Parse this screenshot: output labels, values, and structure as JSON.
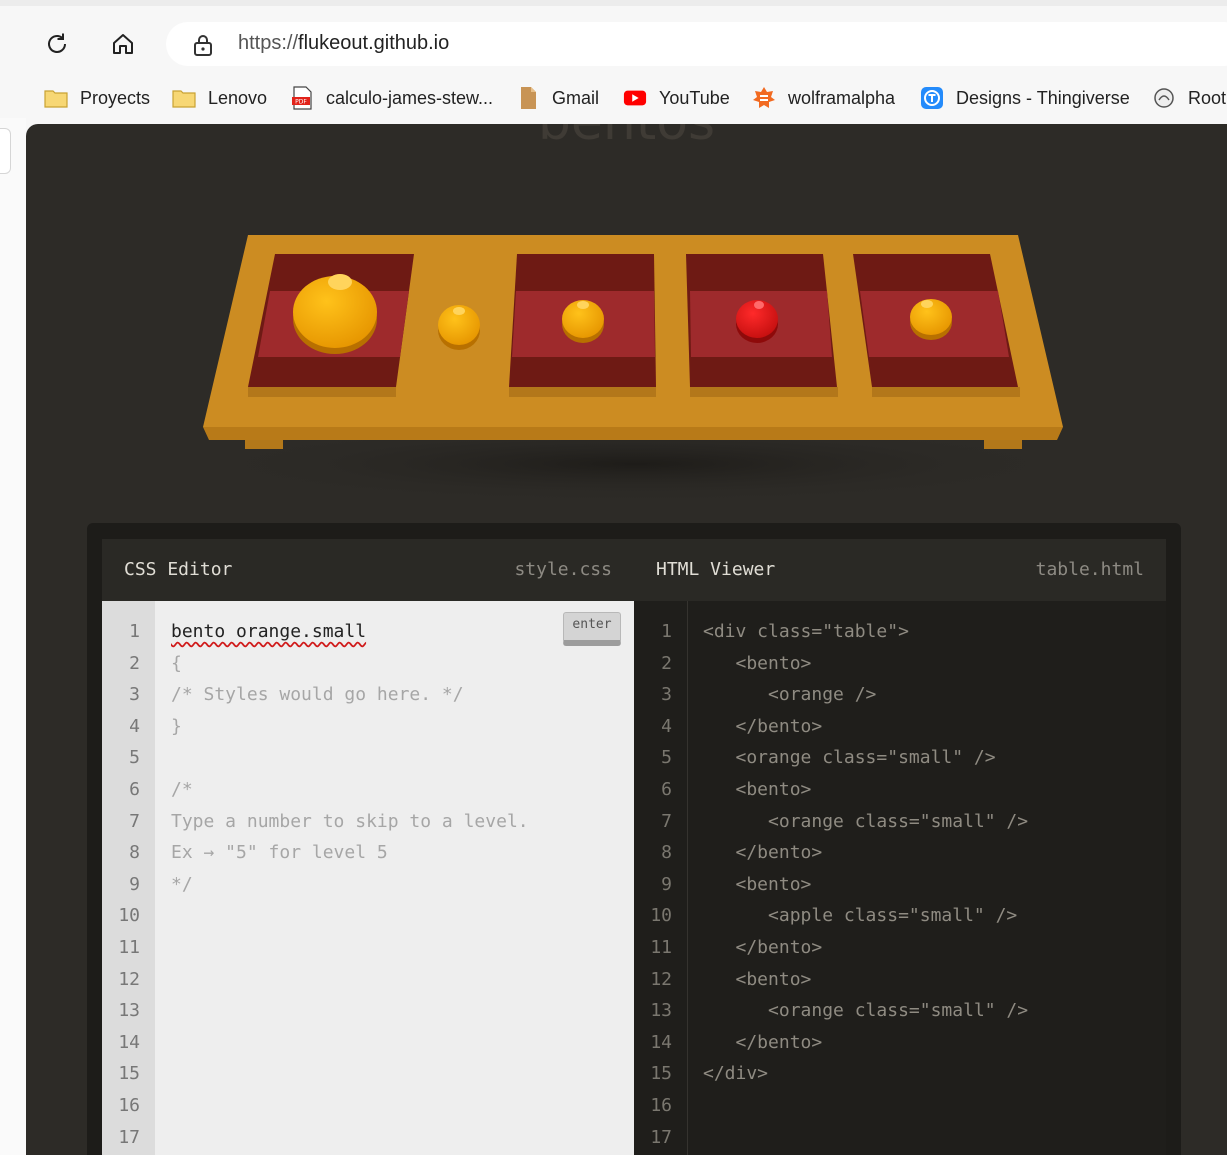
{
  "browser": {
    "url_protocol": "https://",
    "url_host": "flukeout.github.io",
    "bookmarks": [
      {
        "label": "Proyects",
        "icon": "folder-icon"
      },
      {
        "label": "Lenovo",
        "icon": "folder-icon"
      },
      {
        "label": "calculo-james-stew...",
        "icon": "pdf-icon"
      },
      {
        "label": "Gmail",
        "icon": "document-icon"
      },
      {
        "label": "YouTube",
        "icon": "youtube-icon"
      },
      {
        "label": "wolframalpha",
        "icon": "wolfram-icon"
      },
      {
        "label": "Designs - Thingiverse",
        "icon": "thingiverse-icon"
      },
      {
        "label": "Root",
        "icon": "root-icon"
      }
    ]
  },
  "game": {
    "title": "bentos",
    "colors": {
      "table": "#c98a1f",
      "bento": "#9c2a2a",
      "orange": "#f0a000",
      "apple": "#d81616",
      "page_bg": "#2d2b27"
    },
    "table_items": [
      {
        "type": "bento",
        "contains": "orange"
      },
      {
        "type": "orange",
        "class": "small"
      },
      {
        "type": "bento",
        "contains": "orange small"
      },
      {
        "type": "bento",
        "contains": "apple small"
      },
      {
        "type": "bento",
        "contains": "orange small"
      }
    ]
  },
  "css_editor": {
    "title": "CSS Editor",
    "file": "style.css",
    "input_value": "bento orange.small",
    "enter_label": "enter",
    "lines": [
      "",
      "{",
      "/* Styles would go here. */",
      "}",
      "",
      "/*",
      "Type a number to skip to a level.",
      "Ex → \"5\" for level 5",
      "*/"
    ],
    "line_numbers": [
      "1",
      "2",
      "3",
      "4",
      "5",
      "6",
      "7",
      "8",
      "9",
      "10",
      "11",
      "12",
      "13",
      "14",
      "15",
      "16",
      "17"
    ]
  },
  "html_viewer": {
    "title": "HTML Viewer",
    "file": "table.html",
    "lines": [
      "<div class=\"table\">",
      "   <bento>",
      "      <orange />",
      "   </bento>",
      "   <orange class=\"small\" />",
      "   <bento>",
      "      <orange class=\"small\" />",
      "   </bento>",
      "   <bento>",
      "      <apple class=\"small\" />",
      "   </bento>",
      "   <bento>",
      "      <orange class=\"small\" />",
      "   </bento>",
      "</div>"
    ],
    "line_numbers": [
      "1",
      "2",
      "3",
      "4",
      "5",
      "6",
      "7",
      "8",
      "9",
      "10",
      "11",
      "12",
      "13",
      "14",
      "15",
      "16",
      "17"
    ]
  }
}
